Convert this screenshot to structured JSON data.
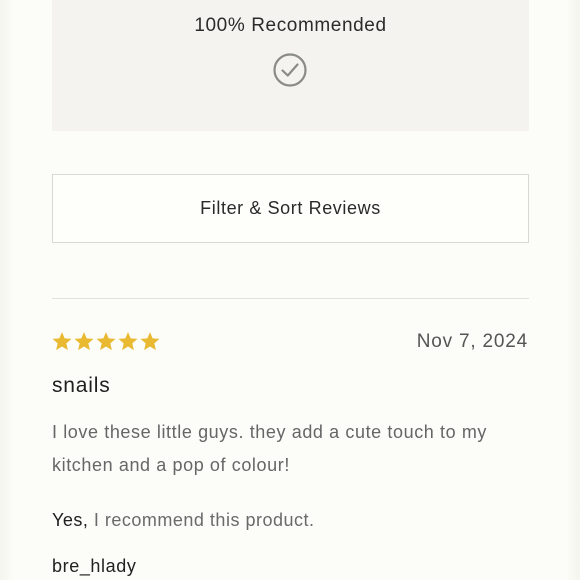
{
  "summary": {
    "recommended_label": "100% Recommended"
  },
  "filter": {
    "button_label": "Filter & Sort Reviews"
  },
  "review": {
    "rating": 5,
    "rating_max": 5,
    "star_color": "#e8b931",
    "date": "Nov 7, 2024",
    "title": "snails",
    "body": "I love these little guys. they add a cute touch to my kitchen and a pop of colour!",
    "recommend_yes": "Yes,",
    "recommend_text": "I recommend this product.",
    "reviewer": "bre_hlady"
  },
  "icons": {
    "recommended": "check-circle-icon",
    "rating": "star-icon"
  }
}
